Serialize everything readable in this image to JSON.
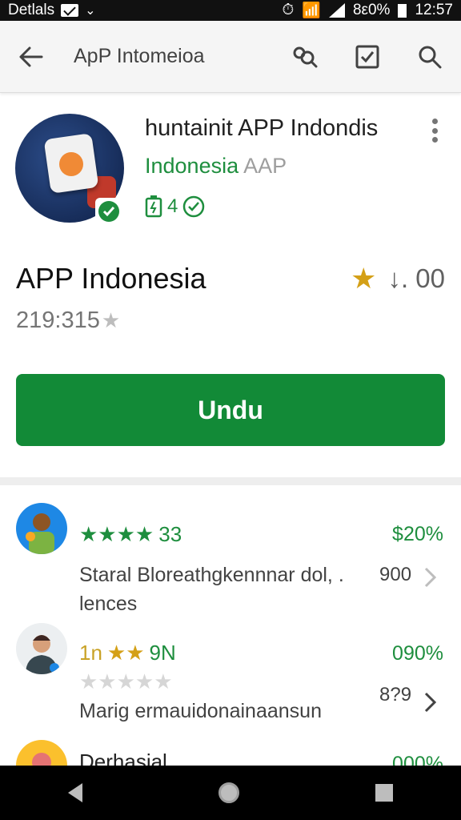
{
  "status_bar": {
    "left_text": "Detlals",
    "percent": "8ε0%",
    "time": "12:57"
  },
  "app_bar": {
    "title": "ApP Intomeioa",
    "icons": [
      "back-arrow-icon",
      "search-person-icon",
      "checkbox-icon",
      "search-icon"
    ]
  },
  "header": {
    "title": "huntainit APP Indondis",
    "subtitle_green": "Indonesia",
    "subtitle_gray": "AAP",
    "meta_value": "4"
  },
  "app": {
    "name": "APP Indonesia",
    "rating": "↓. 00",
    "downloads": "219:315"
  },
  "install_button": {
    "label": "Undu"
  },
  "reviews": [
    {
      "stars_label": "33",
      "percent": "$20%",
      "text_line1": "Staral Bloreathgkennnar dol, .",
      "text_line2": "lences",
      "count": "900"
    },
    {
      "stars_prefix": "1n",
      "stars_label": "9N",
      "percent": "090%",
      "text_line1": "Marig ermauidonainaansun",
      "count": "8?9"
    },
    {
      "name": "Derhasial",
      "percent": "000%"
    }
  ],
  "colors": {
    "green": "#128a37",
    "accent_gold": "#d4a017"
  }
}
